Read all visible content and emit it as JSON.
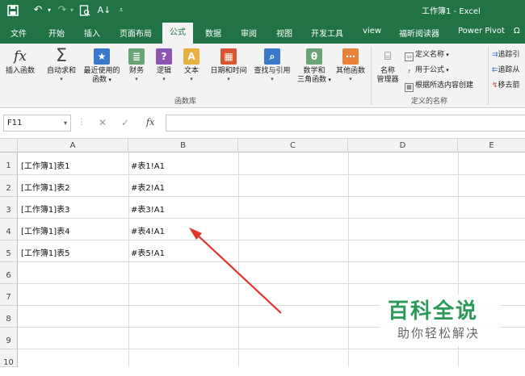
{
  "titlebar": {
    "title": "工作簿1  -  Excel",
    "save_icon": "save-icon",
    "undo_icon": "undo-icon",
    "redo_icon": "redo-icon",
    "print_preview_icon": "print-preview-icon",
    "sort_icon": "sort-icon",
    "customize_icon": "customize-icon"
  },
  "tabs": [
    "文件",
    "开始",
    "插入",
    "页面布局",
    "公式",
    "数据",
    "审阅",
    "视图",
    "开发工具",
    "view",
    "福昕阅读器",
    "Power Pivot",
    "Ω"
  ],
  "active_tab": "公式",
  "ribbon": {
    "insert_function": "插入函数",
    "autosum": [
      "自动求和"
    ],
    "recent": [
      "最近使用的",
      "函数"
    ],
    "finance": [
      "财务"
    ],
    "logic": [
      "逻辑"
    ],
    "text": [
      "文本"
    ],
    "datetime": [
      "日期和时间"
    ],
    "lookup": [
      "查找与引用"
    ],
    "math": [
      "数学和",
      "三角函数"
    ],
    "other": [
      "其他函数"
    ],
    "group_library": "函数库",
    "name_manager": [
      "名称",
      "管理器"
    ],
    "define_name": "定义名称",
    "use_in_formula": "用于公式",
    "create_from_selection": "根据所选内容创建",
    "group_names": "定义的名称",
    "trace_precedents": "追踪引",
    "trace_dependents": "追踪从",
    "remove_arrows": "移去箭"
  },
  "formula_bar": {
    "name_box": "F11",
    "cancel": "✕",
    "enter": "✓",
    "fx": "fx",
    "value": ""
  },
  "sheet": {
    "columns": [
      "A",
      "B",
      "C",
      "D",
      "E"
    ],
    "rows": [
      "1",
      "2",
      "3",
      "4",
      "5",
      "6",
      "7",
      "8",
      "9",
      "10"
    ],
    "cells": [
      [
        "[工作簿1]表1",
        "#表1!A1"
      ],
      [
        "[工作簿1]表2",
        "#表2!A1"
      ],
      [
        "[工作簿1]表3",
        "#表3!A1"
      ],
      [
        "[工作簿1]表4",
        "#表4!A1"
      ],
      [
        "[工作簿1]表5",
        "#表5!A1"
      ]
    ]
  },
  "watermark": {
    "line1": "百科全说",
    "line2": "助你轻松解决"
  },
  "colors": {
    "excel_green": "#217346",
    "annotation_arrow": "#e0342c",
    "watermark_green": "#2b9a58"
  }
}
